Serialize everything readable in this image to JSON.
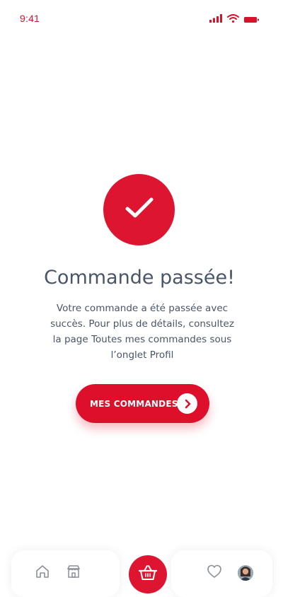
{
  "status_bar": {
    "time": "9:41",
    "icons": [
      "signal-icon",
      "wifi-icon",
      "battery-icon"
    ]
  },
  "success": {
    "icon": "check-icon",
    "title": "Commande passée!",
    "message": "Votre commande a été passée avec succès. Pour plus de détails, consultez la page Toutes mes commandes sous l’onglet Profil"
  },
  "orders_button": {
    "label": "MES COMMANDES",
    "icon": "chevron-right-icon"
  },
  "bottom_nav": {
    "items": [
      "home-icon",
      "store-icon",
      "basket-icon",
      "heart-icon",
      "avatar"
    ]
  },
  "colors": {
    "brand_red": "#dd1531",
    "text": "#4a5568",
    "nav_icon": "#8a8f98"
  }
}
